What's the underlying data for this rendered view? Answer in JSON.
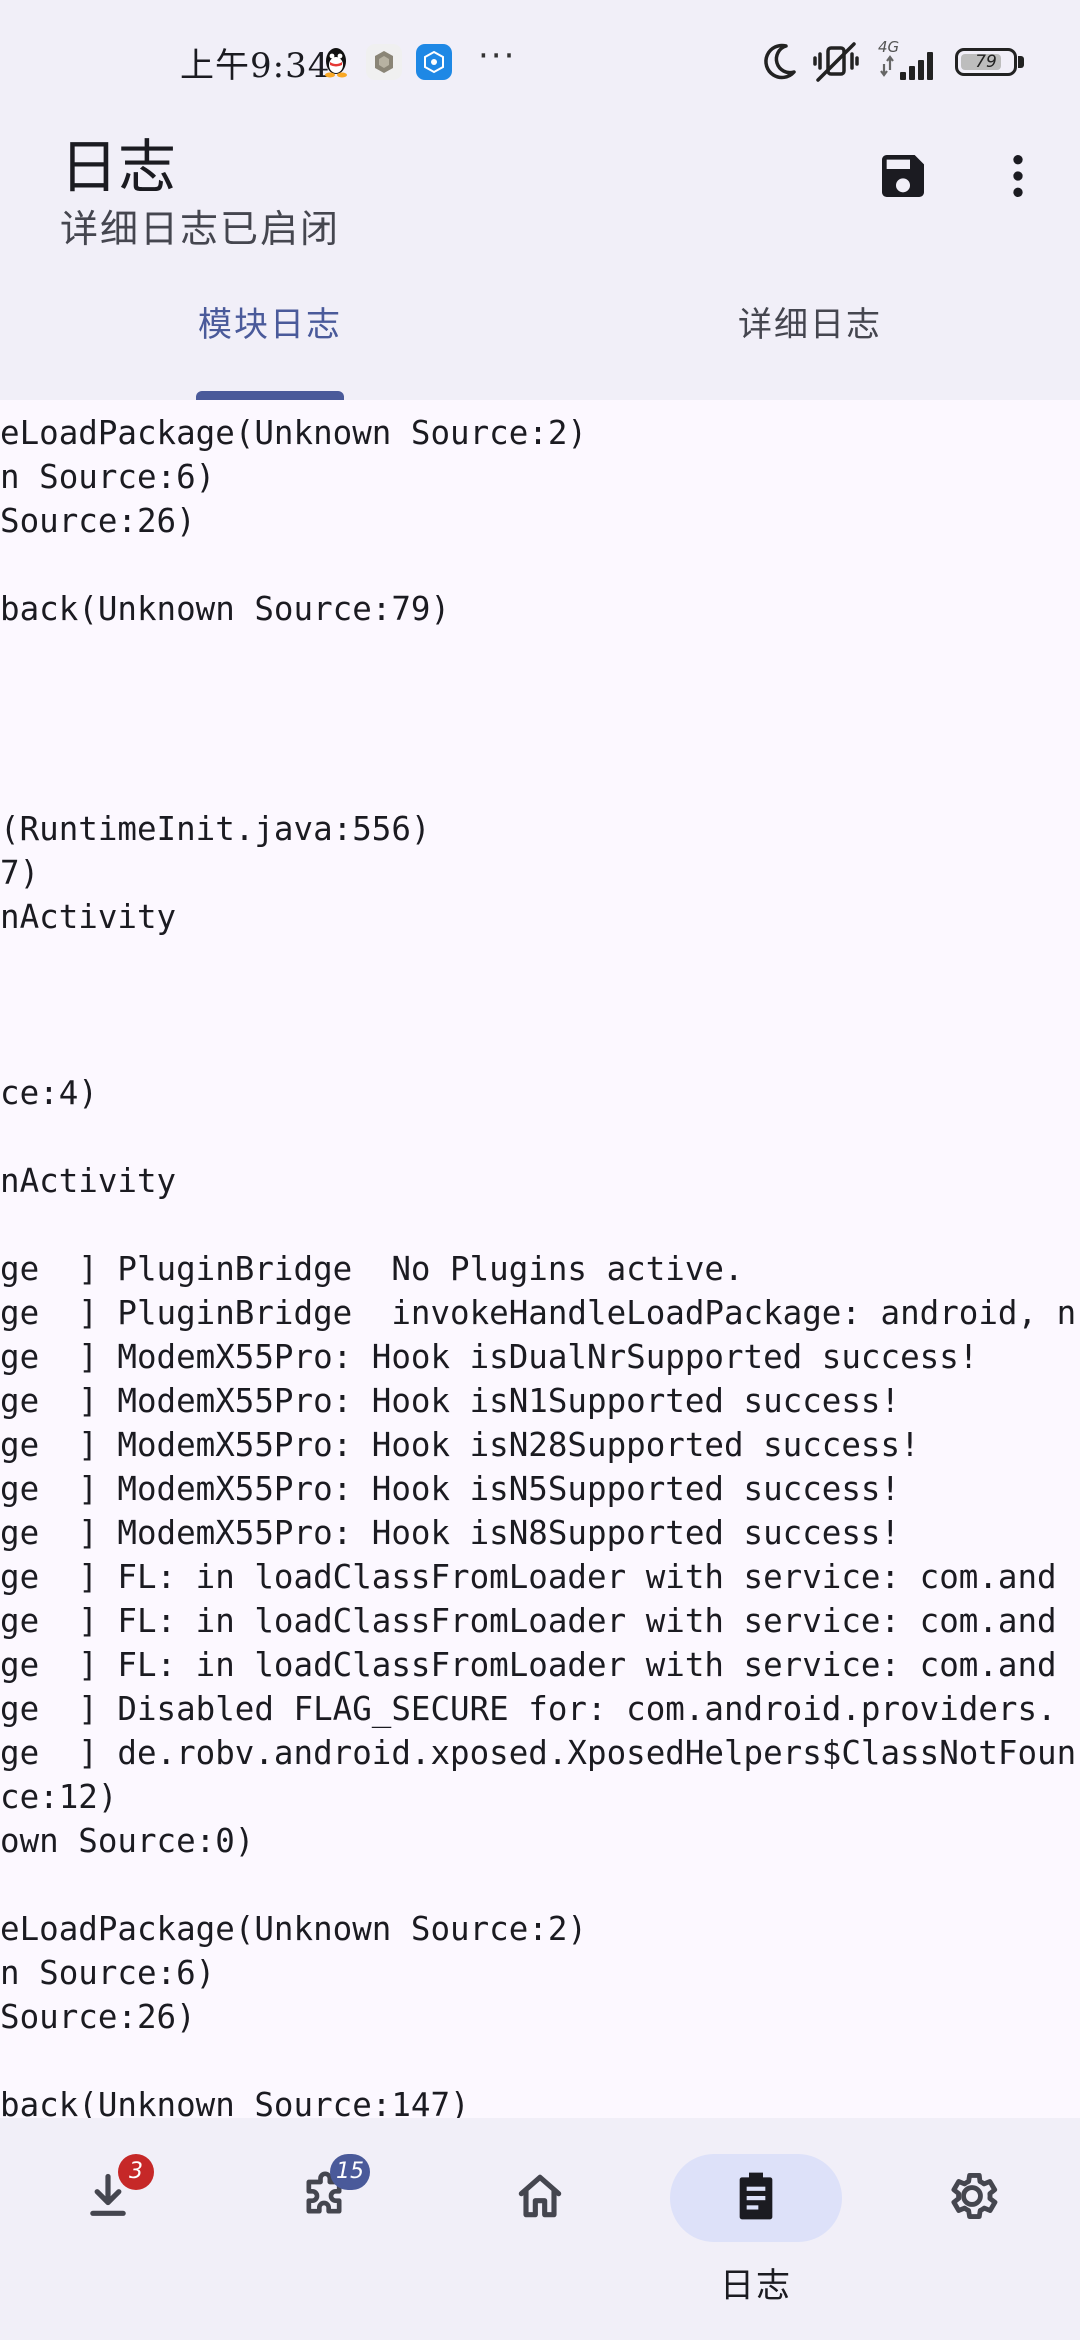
{
  "status_bar": {
    "time": "上午9:34",
    "overflow": "···",
    "network": "4G",
    "battery": "79",
    "battery_level": 0.79,
    "icons": [
      "qq-icon",
      "app-icon",
      "app-icon",
      "moon-icon",
      "mute-icon",
      "signal-icon",
      "battery-icon"
    ]
  },
  "app_bar": {
    "title": "日志",
    "subtitle": "详细日志已启闭",
    "actions": [
      "save-icon",
      "more-vert-icon"
    ]
  },
  "tabs": [
    {
      "label": "模块日志",
      "active": true
    },
    {
      "label": "详细日志",
      "active": false
    }
  ],
  "log_lines": [
    "eLoadPackage(Unknown Source:2)",
    "n Source:6)",
    "Source:26)",
    "",
    "back(Unknown Source:79)",
    "",
    "",
    "",
    "",
    "(RuntimeInit.java:556)",
    "7)",
    "nActivity",
    "",
    "",
    "",
    "ce:4)",
    "",
    "nActivity",
    "",
    "ge  ] PluginBridge  No Plugins active.",
    "ge  ] PluginBridge  invokeHandleLoadPackage: android, n",
    "ge  ] ModemX55Pro: Hook isDualNrSupported success!",
    "ge  ] ModemX55Pro: Hook isN1Supported success!",
    "ge  ] ModemX55Pro: Hook isN28Supported success!",
    "ge  ] ModemX55Pro: Hook isN5Supported success!",
    "ge  ] ModemX55Pro: Hook isN8Supported success!",
    "ge  ] FL: in loadClassFromLoader with service: com.and",
    "ge  ] FL: in loadClassFromLoader with service: com.and",
    "ge  ] FL: in loadClassFromLoader with service: com.and",
    "ge  ] Disabled FLAG_SECURE for: com.android.providers.",
    "ge  ] de.robv.android.xposed.XposedHelpers$ClassNotFoun",
    "ce:12)",
    "own Source:0)",
    "",
    "eLoadPackage(Unknown Source:2)",
    "n Source:6)",
    "Source:26)",
    "",
    "back(Unknown Source:147)"
  ],
  "bottom_nav": [
    {
      "name": "download",
      "icon": "download-icon",
      "badge": "3",
      "badge_color": "#c62828",
      "label": "",
      "selected": false
    },
    {
      "name": "modules",
      "icon": "puzzle-icon",
      "badge": "15",
      "badge_color": "#4a5a9a",
      "label": "",
      "selected": false
    },
    {
      "name": "home",
      "icon": "home-icon",
      "badge": "",
      "badge_color": "",
      "label": "",
      "selected": false
    },
    {
      "name": "logs",
      "icon": "clipboard-icon",
      "badge": "",
      "badge_color": "",
      "label": "日志",
      "selected": true
    },
    {
      "name": "settings",
      "icon": "gear-icon",
      "badge": "",
      "badge_color": "",
      "label": "",
      "selected": false
    }
  ],
  "colors": {
    "accent": "#4a5a9a",
    "surface": "#f1eff8",
    "background": "#fcf8ff",
    "nav_selected": "#dde1f9",
    "badge_red": "#c62828"
  }
}
